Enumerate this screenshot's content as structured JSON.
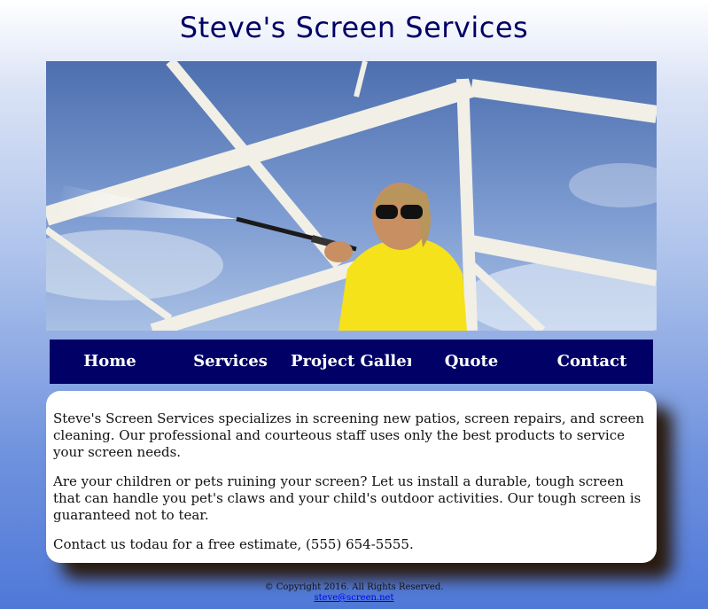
{
  "header": {
    "title": "Steve's Screen Services"
  },
  "hero": {
    "alt": "Person pressure-washing a screen enclosure"
  },
  "nav": {
    "items": [
      {
        "label": "Home"
      },
      {
        "label": "Services"
      },
      {
        "label": "Project Gallery"
      },
      {
        "label": "Quote"
      },
      {
        "label": "Contact"
      }
    ]
  },
  "main": {
    "paragraphs": [
      "Steve's Screen Services specializes in screening new patios, screen repairs, and screen cleaning. Our professional and courteous staff uses only the best products to service your screen needs.",
      "Are your children or pets ruining your screen? Let us install a durable, tough screen that can handle you pet's claws and your child's outdoor activities. Our tough screen is guaranteed not to tear.",
      "Contact us todau for a free estimate, (555) 654-5555."
    ]
  },
  "footer": {
    "copyright": "© Copyright 2016. All Rights Reserved.",
    "email": "steve@screen.net"
  },
  "colors": {
    "nav_bg": "#000066",
    "title": "#000066",
    "shirt": "#f5e21a"
  }
}
